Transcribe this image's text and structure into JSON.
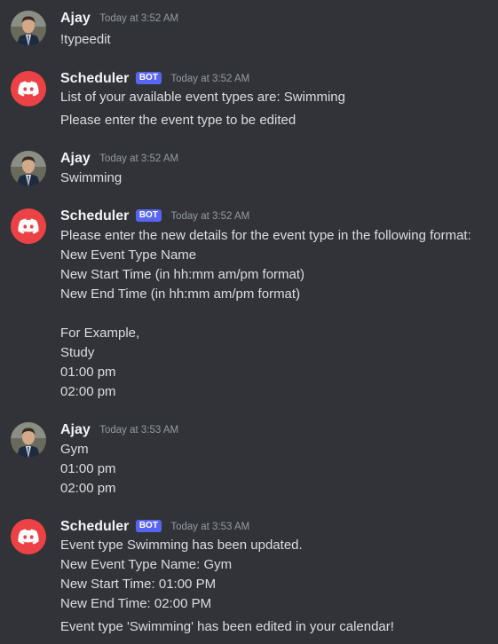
{
  "messages": [
    {
      "author": "Ajay",
      "is_bot": false,
      "avatar": "user-photo-avatar",
      "timestamp": "Today at 3:52 AM",
      "lines": [
        "!typeedit"
      ]
    },
    {
      "author": "Scheduler",
      "is_bot": true,
      "bot_tag": "BOT",
      "avatar": "discord-logo-icon",
      "timestamp": "Today at 3:52 AM",
      "lines": [
        "List of your available event types are: Swimming",
        "Please enter the event type to be edited"
      ]
    },
    {
      "author": "Ajay",
      "is_bot": false,
      "avatar": "user-photo-avatar",
      "timestamp": "Today at 3:52 AM",
      "lines": [
        "Swimming"
      ]
    },
    {
      "author": "Scheduler",
      "is_bot": true,
      "bot_tag": "BOT",
      "avatar": "discord-logo-icon",
      "timestamp": "Today at 3:52 AM",
      "lines": [
        "Please enter the new details for the event type in the following format:",
        "New Event Type Name",
        "New Start Time (in hh:mm am/pm format)",
        "New End Time (in hh:mm am/pm format)",
        "",
        "For Example,",
        "Study",
        "01:00 pm",
        "02:00 pm"
      ]
    },
    {
      "author": "Ajay",
      "is_bot": false,
      "avatar": "user-photo-avatar",
      "timestamp": "Today at 3:53 AM",
      "lines": [
        "Gym",
        "01:00 pm",
        "02:00 pm"
      ]
    },
    {
      "author": "Scheduler",
      "is_bot": true,
      "bot_tag": "BOT",
      "avatar": "discord-logo-icon",
      "timestamp": "Today at 3:53 AM",
      "lines": [
        "Event type Swimming has been updated.",
        "New Event Type Name: Gym",
        "New Start Time: 01:00 PM",
        "New End Time: 02:00 PM",
        "Event type 'Swimming' has been edited in your calendar!"
      ]
    }
  ],
  "colors": {
    "background": "#313338",
    "author": "#f2f3f5",
    "text": "#dbdee1",
    "timestamp": "#949ba4",
    "bot_tag": "#5865f2",
    "discord_avatar": "#ed4245"
  }
}
